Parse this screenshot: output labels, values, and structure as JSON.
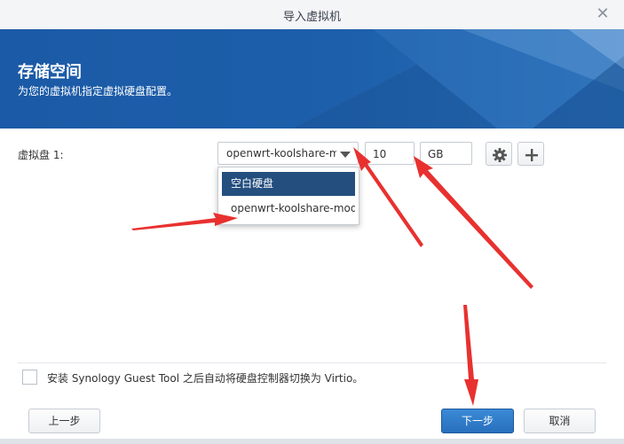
{
  "window": {
    "title": "导入虚拟机",
    "close_icon": "close-icon"
  },
  "banner": {
    "heading": "存储空间",
    "subtitle": "为您的虚拟机指定虚拟硬盘配置。"
  },
  "disk": {
    "label": "虚拟盘 1:",
    "selected_value": "openwrt-koolshare-mod",
    "size_value": "10",
    "unit": "GB",
    "options": [
      "空白硬盘",
      "openwrt-koolshare-mod"
    ],
    "settings_icon": "gear-icon",
    "add_icon": "plus-icon"
  },
  "guest_tool": {
    "label": "安装 Synology Guest Tool 之后自动将硬盘控制器切换为 Virtio。",
    "checked": false
  },
  "buttons": {
    "prev": "上一步",
    "next": "下一步",
    "cancel": "取消"
  },
  "annotations": {
    "arrow_color": "#e8312f"
  },
  "colors": {
    "banner": "#1d5faa",
    "primary": "#2870bd",
    "selected_option": "#234e7e"
  }
}
